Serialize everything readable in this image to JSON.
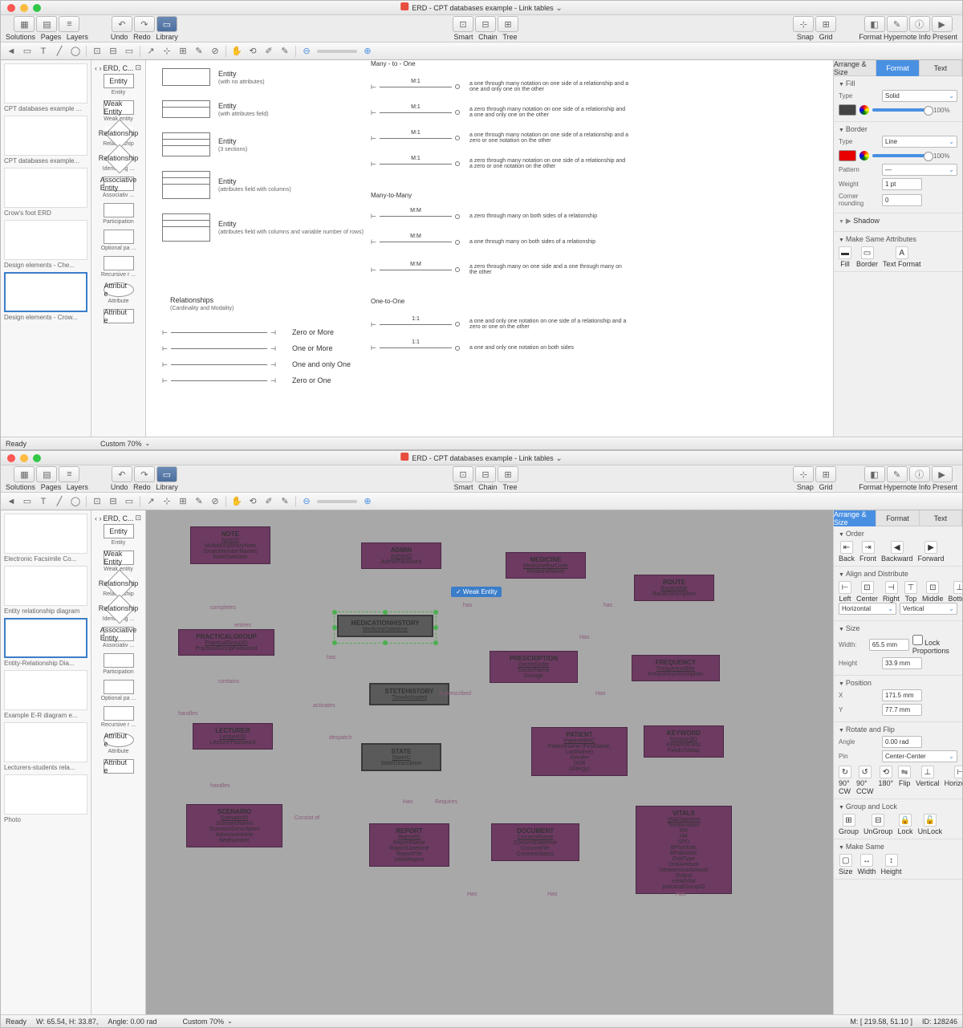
{
  "app_title": "ERD - CPT databases example - Link tables",
  "toolbar": {
    "groups_left": [
      "Solutions",
      "Pages",
      "Layers"
    ],
    "undo": "Undo",
    "redo": "Redo",
    "library": "Library",
    "center": [
      "Smart",
      "Chain",
      "Tree"
    ],
    "snap": "Snap",
    "grid": "Grid",
    "right": [
      "Format",
      "Hypernote",
      "Info",
      "Present"
    ]
  },
  "app1": {
    "thumbs": [
      "CPT databases example ...",
      "CPT databases example...",
      "Crow's foot ERD",
      "Design elements - Che...",
      "Design elements - Crow..."
    ],
    "selected_thumb": 4,
    "lib": [
      {
        "s": "Entity",
        "l": "Entity"
      },
      {
        "s": "Weak Entity",
        "l": "Weak entity"
      },
      {
        "s": "Relationship",
        "l": "Relationship"
      },
      {
        "s": "Relationship",
        "l": "Identifying ..."
      },
      {
        "s": "Associative Entity",
        "l": "Associativ ..."
      },
      {
        "s": "",
        "l": "Participation"
      },
      {
        "s": "",
        "l": "Optional pa ..."
      },
      {
        "s": "",
        "l": "Recursive r ..."
      },
      {
        "s": "Attribut e",
        "l": "Attribute"
      },
      {
        "s": "Attribut e",
        "l": ""
      }
    ],
    "libhead": "ERD, C...",
    "legend_entities": [
      {
        "name": "Entity",
        "sub": "(with no attributes)"
      },
      {
        "name": "Entity",
        "sub": "(with attributes field)"
      },
      {
        "name": "Entity",
        "sub": "(3 sections)"
      },
      {
        "name": "Entity",
        "sub": "(attributes field with columns)"
      },
      {
        "name": "Entity",
        "sub": "(attributes field with columns and variable number of rows)"
      }
    ],
    "rel_header": {
      "name": "Relationships",
      "sub": "(Cardinality and Modality)"
    },
    "cardinality": [
      "Zero or More",
      "One or More",
      "One and only One",
      "Zero or One"
    ],
    "conn_sections": [
      {
        "h": "Many - to - One",
        "rows": [
          {
            "l": "M:1",
            "d": "a one through many notation on one side of a relationship and a one and only one on the other"
          },
          {
            "l": "M:1",
            "d": "a zero through many notation on one side of a relationship and a one and only one on the other"
          },
          {
            "l": "M:1",
            "d": "a one through many notation on one side of a relationship and a zero or one notation on the other"
          },
          {
            "l": "M:1",
            "d": "a zero through many notation on one side of a relationship and a zero or one notation on the other"
          }
        ]
      },
      {
        "h": "Many-to-Many",
        "rows": [
          {
            "l": "M:M",
            "d": "a zero through many on both sides of a relationship"
          },
          {
            "l": "M:M",
            "d": "a one through many on both sides of a relationship"
          },
          {
            "l": "M:M",
            "d": "a zero through many on one side and a one through many on the other"
          }
        ]
      },
      {
        "h": "One-to-One",
        "rows": [
          {
            "l": "1:1",
            "d": "a one and only one notation on one side of a relationship and a zero or one on the other"
          },
          {
            "l": "1:1",
            "d": "a one and only one notation on both sides"
          }
        ]
      }
    ],
    "rightpanel": {
      "tabs": [
        "Arrange & Size",
        "Format",
        "Text"
      ],
      "active": 1,
      "fill": {
        "type": "Solid",
        "opacity": "100%",
        "color": "#444"
      },
      "border": {
        "type": "Line",
        "opacity": "100%",
        "color": "#e80000",
        "pattern": "—",
        "weight": "1 pt",
        "corner": "0"
      },
      "shadow": "Shadow",
      "makesame": {
        "label": "Make Same Attributes",
        "items": [
          "Fill",
          "Border",
          "Text Format"
        ]
      }
    },
    "status": "Ready",
    "zoom": "Custom 70%"
  },
  "app2": {
    "thumbs": [
      "Electronic Facsimile Co...",
      "Entity relationship diagram",
      "Entity-Relationship Dia...",
      "Example E-R diagram e...",
      "Lecturers-students rela...",
      "Photo"
    ],
    "selected_thumb": 2,
    "lib": [
      {
        "s": "Entity",
        "l": "Entity"
      },
      {
        "s": "Weak Entity",
        "l": "Weak entity"
      },
      {
        "s": "Relationship",
        "l": "Relationship"
      },
      {
        "s": "Relationship",
        "l": "Identifying ..."
      },
      {
        "s": "Associative Entity",
        "l": "Associativ ..."
      },
      {
        "s": "",
        "l": "Participation"
      },
      {
        "s": "",
        "l": "Optional pa ..."
      },
      {
        "s": "",
        "l": "Recursive r ..."
      },
      {
        "s": "Attribut e",
        "l": "Attribute"
      },
      {
        "s": "Attribut e",
        "l": ""
      }
    ],
    "libhead": "ERD, C...",
    "tooltip": "✓ Weak Entity",
    "entities": {
      "note": {
        "n": "NOTE",
        "a": [
          "NoteID",
          "MultidisciplinaryNote",
          "GropuMemberNames",
          "NoteDatetime"
        ]
      },
      "admin": {
        "n": "ADMIN",
        "a": [
          "AdminID",
          "AdminPassword"
        ]
      },
      "medicine": {
        "n": "MEDICINE",
        "a": [
          "MedicineBarCode",
          "MedicineName"
        ]
      },
      "route": {
        "n": "ROUTE",
        "a": [
          "RouteAbbr",
          "RouteDescription"
        ]
      },
      "practicalgroup": {
        "n": "PRACTICALGROUP",
        "a": [
          "PracticalGroupID",
          "PracticalGroupPassword"
        ]
      },
      "medhist": {
        "n": "MEDICATIONHISTORY",
        "a": [
          "MedicineDatetime"
        ]
      },
      "prescription": {
        "n": "PRESCRIPTION",
        "a": [
          "DoctorOrder",
          "DoctorName",
          "Dosage"
        ]
      },
      "frequency": {
        "n": "FREQUENCY",
        "a": [
          "FrequencyAbbr",
          "FrequencyDescription"
        ]
      },
      "lecturer": {
        "n": "LECTURER",
        "a": [
          "LecturerID",
          "LecturerPassword"
        ]
      },
      "stetehistory": {
        "n": "STETEHISTORY",
        "a": [
          "TimeActivated"
        ]
      },
      "state": {
        "n": "STATE",
        "a": [
          "StateID",
          "StateDescription"
        ]
      },
      "patient": {
        "n": "PATIENT",
        "a": [
          "PatientNRIC",
          "PatientName (FirstName, LastName)",
          "Gender",
          "DOB",
          "(Allergy)"
        ]
      },
      "keyword": {
        "n": "KEYWORD",
        "a": [
          "KeywordID",
          "KeywordDesc",
          "FieldsToMap"
        ]
      },
      "scenario": {
        "n": "SCENARIO",
        "a": [
          "ScenarioID",
          "ScenarioName",
          "ScenarioDescritpion",
          "AdmissionNote",
          "BedNumber"
        ]
      },
      "report": {
        "n": "REPORT",
        "a": [
          "ReportID",
          "ReportName",
          "RaportDatetime",
          "ReportFile",
          "initialReport"
        ]
      },
      "document": {
        "n": "DOCUMENT",
        "a": [
          "ConsentName",
          "ConsentDatetime",
          "ConcertFile",
          "ConsentStatus"
        ]
      },
      "vitals": {
        "n": "VITALS",
        "a": [
          "VitalDatetime",
          "Temperature",
          "RR",
          "HR",
          "SPO",
          "BPsystolic",
          "BPdiastolic",
          "OralType",
          "OralAmount",
          "IntravenousAmount",
          "Output",
          "initialVital",
          "practicalGroupID"
        ]
      }
    },
    "rels": [
      "completes",
      "has",
      "has",
      "Has",
      "entries",
      "has",
      "contains",
      "handles",
      "activates",
      "despatch",
      "Is prescribed",
      "Has",
      "handles",
      "Consist of",
      "Has",
      "Requires",
      "Has",
      "Has",
      "Has"
    ],
    "rightpanel": {
      "tabs": [
        "Arrange & Size",
        "Format",
        "Text"
      ],
      "active": 0,
      "order": {
        "label": "Order",
        "items": [
          "Back",
          "Front",
          "Backward",
          "Forward"
        ]
      },
      "align": {
        "label": "Align and Distribute",
        "items": [
          "Left",
          "Center",
          "Right",
          "Top",
          "Middle",
          "Bottom"
        ],
        "h": "Horizontal",
        "v": "Vertical"
      },
      "size": {
        "label": "Size",
        "w": "65.5 mm",
        "h": "33.9 mm",
        "lock": "Lock Proportions"
      },
      "position": {
        "label": "Position",
        "x": "171.5 mm",
        "y": "77.7 mm"
      },
      "rotate": {
        "label": "Rotate and Flip",
        "angle": "0.00 rad",
        "pin": "Center-Center",
        "items": [
          "90° CW",
          "90° CCW",
          "180°",
          "Flip",
          "Vertical",
          "Horizontal"
        ]
      },
      "group": {
        "label": "Group and Lock",
        "items": [
          "Group",
          "UnGroup",
          "Lock",
          "UnLock"
        ]
      },
      "makesame": {
        "label": "Make Same",
        "items": [
          "Size",
          "Width",
          "Height"
        ]
      }
    },
    "status": {
      "ready": "Ready",
      "w": "W: 65.54,  H: 33.87,",
      "angle": "Angle: 0.00 rad",
      "m": "M: [ 219.58, 51.10 ]",
      "id": "ID: 128246"
    },
    "zoom": "Custom 70%"
  }
}
